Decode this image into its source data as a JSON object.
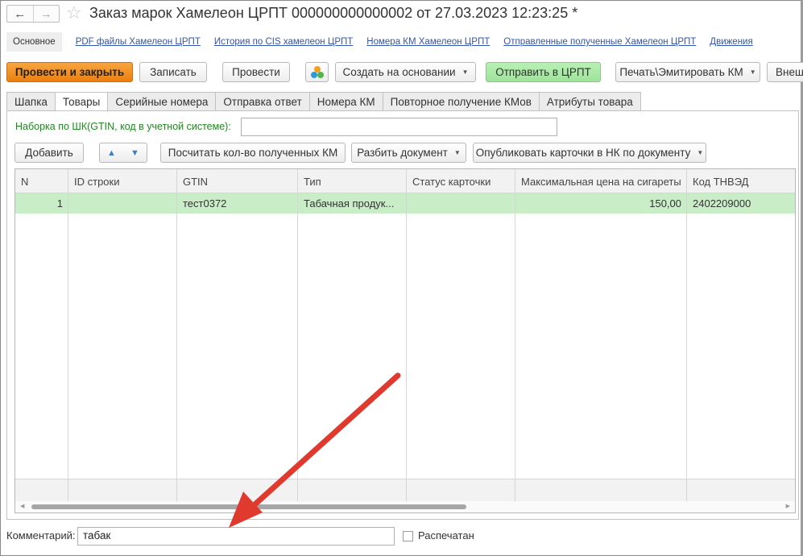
{
  "window": {
    "title": "Заказ марок Хамелеон ЦРПТ 000000000000002 от 27.03.2023 12:23:25 *",
    "back_glyph": "←",
    "forward_glyph": "→",
    "star_glyph": "☆"
  },
  "links": {
    "main": "Основное",
    "items": [
      "PDF файлы  Хамелеон ЦРПТ",
      "История по CIS хамелеон ЦРПТ",
      "Номера КМ Хамелеон ЦРПТ",
      "Отправленные полученные Хамелеон ЦРПТ",
      "Движения"
    ]
  },
  "toolbar": {
    "post_close": "Провести и закрыть",
    "save": "Записать",
    "post": "Провести",
    "create_based": "Создать на основании",
    "send": "Отправить в ЦРПТ",
    "print": "Печать\\Эмитировать КМ",
    "external": "Внеш"
  },
  "tabs": [
    "Шапка",
    "Товары",
    "Серийные номера",
    "Отправка ответ",
    "Номера КМ",
    "Повторное получение КМов",
    "Атрибуты товара"
  ],
  "active_tab": 1,
  "goods": {
    "barcode_label": "Наборка по ШК(GTIN, код в учетной системе):",
    "barcode_value": "",
    "add": "Добавить",
    "up_glyph": "▲",
    "down_glyph": "▼",
    "count": "Посчитать кол-во полученных КМ",
    "split": "Разбить документ",
    "publish": "Опубликовать карточки в НК по документу"
  },
  "table": {
    "columns": [
      "N",
      "ID строки",
      "GTIN",
      "Тип",
      "Статус карточки",
      "Максимальная цена на сигареты",
      "Код ТНВЭД"
    ],
    "rows": [
      {
        "n": "1",
        "id": "",
        "gtin": "тест0372",
        "type": "Табачная продук...",
        "status": "",
        "price": "150,00",
        "tnved": "2402209000"
      }
    ]
  },
  "footer": {
    "comment_label": "Комментарий:",
    "comment_value": "табак",
    "printed_label": "Распечатан",
    "printed": false
  },
  "colors": {
    "primary_button": "#eb7f10",
    "send_button": "#9fe39b",
    "selected_row": "#c9edc6",
    "link": "#3355aa",
    "green_label": "#1c8a1c",
    "annotation_arrow": "#e03a2e"
  }
}
